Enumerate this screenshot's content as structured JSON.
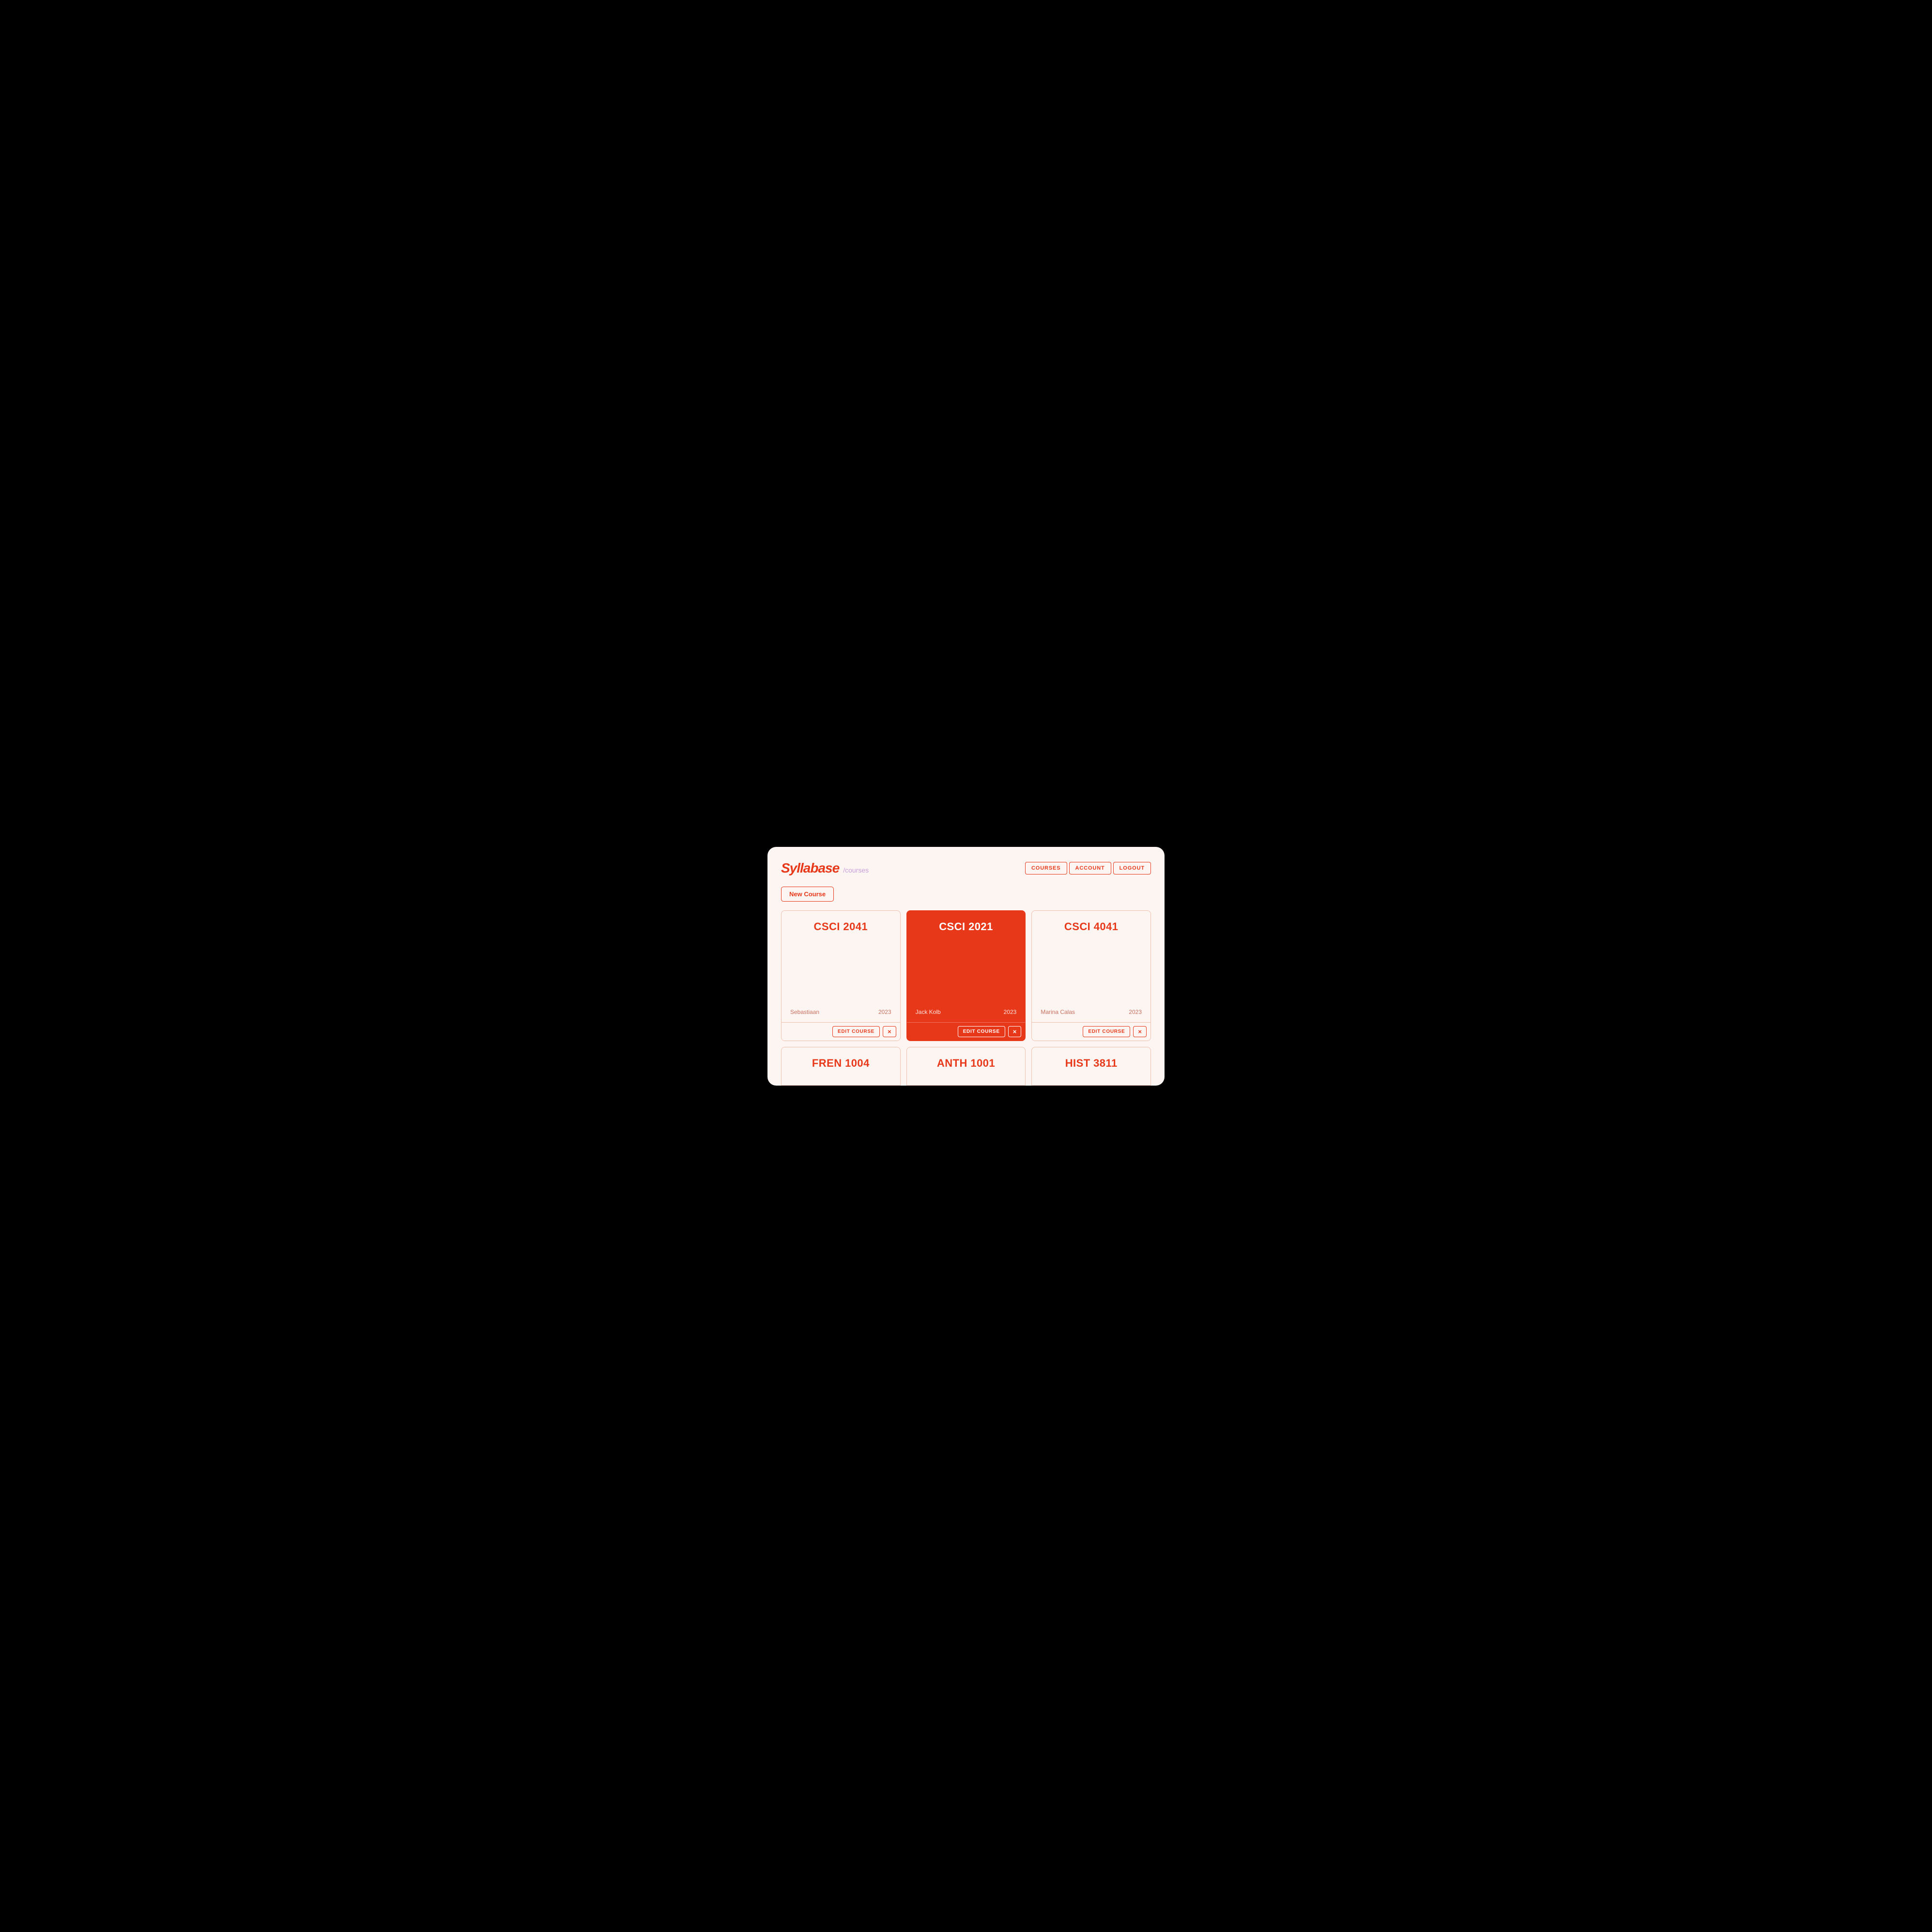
{
  "app": {
    "logo": "Syllabase",
    "path": "/courses"
  },
  "nav": {
    "items": [
      {
        "id": "courses",
        "label": "COURSES"
      },
      {
        "id": "account",
        "label": "ACCOUNT"
      },
      {
        "id": "logout",
        "label": "LOGOUT"
      }
    ]
  },
  "toolbar": {
    "new_course_label": "New Course"
  },
  "courses": [
    {
      "id": "csci-2041",
      "title": "CSCI 2041",
      "instructor": "Sebastiaan",
      "year": "2023",
      "active": false
    },
    {
      "id": "csci-2021",
      "title": "CSCI 2021",
      "instructor": "Jack Kolb",
      "year": "2023",
      "active": true
    },
    {
      "id": "csci-4041",
      "title": "CSCI 4041",
      "instructor": "Marina Calas",
      "year": "2023",
      "active": false
    }
  ],
  "partial_courses": [
    {
      "id": "fren-1004",
      "title": "FREN 1004"
    },
    {
      "id": "anth-1001",
      "title": "ANTH 1001"
    },
    {
      "id": "hist-3811",
      "title": "HIST 3811"
    }
  ],
  "actions": {
    "edit_label": "EDIT COURSE",
    "delete_symbol": "×"
  }
}
